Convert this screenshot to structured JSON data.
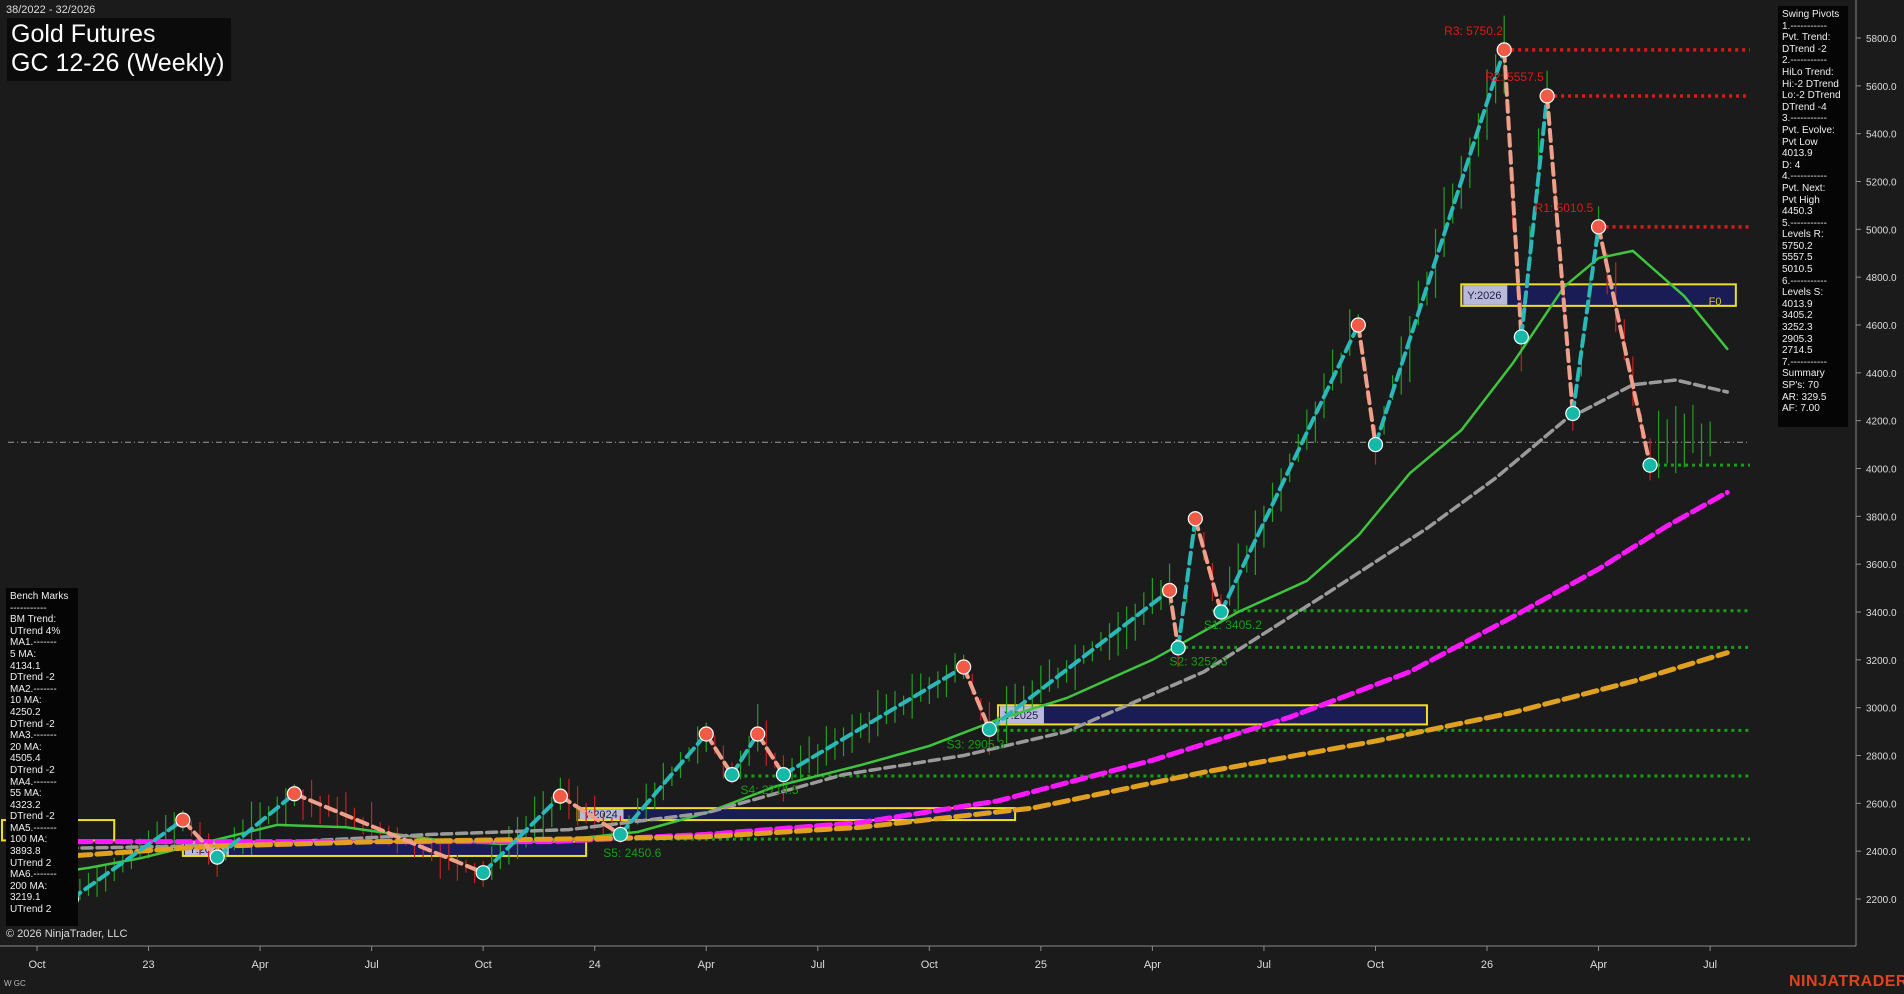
{
  "header": {
    "date_range": "38/2022 - 32/2026",
    "title_line1": "Gold Futures",
    "title_line2": "GC 12-26 (Weekly)"
  },
  "footer": {
    "copyright": "© 2026 NinjaTrader, LLC",
    "symbol": "W GC",
    "brand": "NINJATRADER"
  },
  "swing_pivots_panel": {
    "lines": [
      "Swing Pivots",
      "1.-----------",
      "Pvt. Trend:",
      "DTrend -2",
      "2.-----------",
      "HiLo Trend:",
      "Hi:-2 DTrend",
      "Lo:-2 DTrend",
      "DTrend -4",
      "3.-----------",
      "Pvt. Evolve:",
      "Pvt Low",
      "4013.9",
      "D: 4",
      "4.-----------",
      "Pvt. Next:",
      "Pvt High",
      "4450.3",
      "5.-----------",
      "Levels R:",
      "5750.2",
      "5557.5",
      "5010.5",
      "6.-----------",
      "Levels S:",
      "4013.9",
      "3405.2",
      "3252.3",
      "2905.3",
      "2714.5",
      "7.-----------",
      "Summary",
      "SP's: 70",
      "AR: 329.5",
      "AF: 7.00"
    ]
  },
  "bench_marks_panel": {
    "lines": [
      "Bench Marks",
      "-----------",
      "BM Trend:",
      "UTrend 4%",
      "MA1.-------",
      "5 MA:",
      "4134.1",
      "DTrend -2",
      "MA2.-------",
      "10 MA:",
      "4250.2",
      "DTrend -2",
      "MA3.-------",
      "20 MA:",
      "4505.4",
      "DTrend -2",
      "MA4.-------",
      "55 MA:",
      "4323.2",
      "DTrend -2",
      "MA5.-------",
      "100 MA:",
      "3893.8",
      "UTrend 2",
      "MA6.-------",
      "200 MA:",
      "3219.1",
      "UTrend 2"
    ]
  },
  "chart_data": {
    "type": "candlestick",
    "timeframe": "Weekly",
    "y_axis": {
      "ylim": [
        2100,
        5950
      ],
      "ticks": [
        2200,
        2400,
        2600,
        2800,
        3000,
        3200,
        3400,
        3600,
        3800,
        4000,
        4200,
        4400,
        4600,
        4800,
        5000,
        5200,
        5400,
        5600,
        5800
      ],
      "tick_labels": [
        "2200.0",
        "2400.0",
        "2600.0",
        "2800.0",
        "3000.0",
        "3200.0",
        "3400.0",
        "3600.0",
        "3800.0",
        "4000.0",
        "4200.0",
        "4400.0",
        "4600.0",
        "4800.0",
        "5000.0",
        "5200.0",
        "5400.0",
        "5600.0",
        "5800.0"
      ]
    },
    "x_axis": {
      "labels": [
        "Oct",
        "23",
        "Apr",
        "Jul",
        "Oct",
        "24",
        "Apr",
        "Jul",
        "Oct",
        "25",
        "Apr",
        "Jul",
        "Oct",
        "26",
        "Apr",
        "Jul"
      ],
      "label_week_index": [
        0,
        13,
        26,
        39,
        52,
        65,
        78,
        91,
        104,
        117,
        130,
        143,
        156,
        169,
        182,
        195
      ],
      "total_weeks": 204
    },
    "last_price": 4110,
    "resistance_levels": [
      {
        "label": "R3: 5750.2",
        "value": 5750.2
      },
      {
        "label": "R2: 5557.5",
        "value": 5557.5
      },
      {
        "label": "R1: 5010.5",
        "value": 5010.5
      }
    ],
    "support_levels": [
      {
        "label": "",
        "value": 4013.9
      },
      {
        "label": "S1: 3405.2",
        "value": 3405.2
      },
      {
        "label": "S2: 3252.3",
        "value": 3252.3
      },
      {
        "label": "S3: 2905.3",
        "value": 2905.3
      },
      {
        "label": "S4: 2714.5",
        "value": 2714.5
      },
      {
        "label": "S5: 2450.6",
        "value": 2450.6
      }
    ],
    "swing_pivots": [
      {
        "w": 4,
        "p": 2200,
        "type": "low"
      },
      {
        "w": 17,
        "p": 2530,
        "type": "high"
      },
      {
        "w": 21,
        "p": 2375,
        "type": "low"
      },
      {
        "w": 30,
        "p": 2640,
        "type": "high"
      },
      {
        "w": 52,
        "p": 2310,
        "type": "low"
      },
      {
        "w": 61,
        "p": 2630,
        "type": "high"
      },
      {
        "w": 68,
        "p": 2470,
        "type": "low"
      },
      {
        "w": 78,
        "p": 2890,
        "type": "high"
      },
      {
        "w": 81,
        "p": 2720,
        "type": "low"
      },
      {
        "w": 84,
        "p": 2890,
        "type": "high"
      },
      {
        "w": 87,
        "p": 2720,
        "type": "low"
      },
      {
        "w": 108,
        "p": 3170,
        "type": "high"
      },
      {
        "w": 111,
        "p": 2910,
        "type": "low"
      },
      {
        "w": 132,
        "p": 3490,
        "type": "high"
      },
      {
        "w": 133,
        "p": 3250,
        "type": "low"
      },
      {
        "w": 135,
        "p": 3790,
        "type": "high"
      },
      {
        "w": 138,
        "p": 3400,
        "type": "low"
      },
      {
        "w": 154,
        "p": 4600,
        "type": "high"
      },
      {
        "w": 156,
        "p": 4100,
        "type": "low"
      },
      {
        "w": 171,
        "p": 5750.2,
        "type": "high"
      },
      {
        "w": 173,
        "p": 4550,
        "type": "low"
      },
      {
        "w": 176,
        "p": 5557.5,
        "type": "high"
      },
      {
        "w": 179,
        "p": 4230,
        "type": "low"
      },
      {
        "w": 182,
        "p": 5010.5,
        "type": "high"
      },
      {
        "w": 188,
        "p": 4013.9,
        "type": "low"
      }
    ],
    "moving_averages": [
      {
        "name": "20 MA",
        "color": "#3ec43e",
        "points": [
          [
            0,
            2300
          ],
          [
            6,
            2330
          ],
          [
            12,
            2370
          ],
          [
            20,
            2440
          ],
          [
            28,
            2510
          ],
          [
            36,
            2500
          ],
          [
            46,
            2450
          ],
          [
            54,
            2430
          ],
          [
            62,
            2450
          ],
          [
            70,
            2480
          ],
          [
            78,
            2560
          ],
          [
            86,
            2670
          ],
          [
            96,
            2760
          ],
          [
            104,
            2840
          ],
          [
            112,
            2950
          ],
          [
            120,
            3040
          ],
          [
            130,
            3200
          ],
          [
            140,
            3400
          ],
          [
            148,
            3530
          ],
          [
            154,
            3720
          ],
          [
            160,
            3980
          ],
          [
            166,
            4160
          ],
          [
            172,
            4440
          ],
          [
            178,
            4760
          ],
          [
            182,
            4880
          ],
          [
            186,
            4910
          ],
          [
            192,
            4720
          ],
          [
            197,
            4500
          ]
        ]
      },
      {
        "name": "55 MA",
        "color": "#9a9a9a",
        "points": [
          [
            0,
            2410
          ],
          [
            16,
            2420
          ],
          [
            30,
            2440
          ],
          [
            46,
            2470
          ],
          [
            62,
            2490
          ],
          [
            78,
            2560
          ],
          [
            94,
            2720
          ],
          [
            108,
            2800
          ],
          [
            120,
            2900
          ],
          [
            136,
            3150
          ],
          [
            150,
            3470
          ],
          [
            162,
            3750
          ],
          [
            170,
            3960
          ],
          [
            178,
            4200
          ],
          [
            186,
            4350
          ],
          [
            191,
            4370
          ],
          [
            197,
            4320
          ]
        ]
      },
      {
        "name": "100 MA",
        "color": "#ff19ff",
        "points": [
          [
            0,
            2440
          ],
          [
            20,
            2440
          ],
          [
            40,
            2440
          ],
          [
            60,
            2440
          ],
          [
            78,
            2470
          ],
          [
            96,
            2520
          ],
          [
            112,
            2610
          ],
          [
            130,
            2780
          ],
          [
            146,
            2960
          ],
          [
            160,
            3150
          ],
          [
            172,
            3380
          ],
          [
            182,
            3580
          ],
          [
            190,
            3760
          ],
          [
            197,
            3900
          ]
        ]
      },
      {
        "name": "200 MA",
        "color": "#e0a020",
        "points": [
          [
            0,
            2370
          ],
          [
            20,
            2420
          ],
          [
            40,
            2440
          ],
          [
            60,
            2450
          ],
          [
            78,
            2460
          ],
          [
            96,
            2500
          ],
          [
            116,
            2580
          ],
          [
            136,
            2730
          ],
          [
            156,
            2860
          ],
          [
            172,
            2980
          ],
          [
            186,
            3110
          ],
          [
            197,
            3230
          ]
        ]
      }
    ],
    "yearly_boxes": [
      {
        "label": "Y:2023",
        "w0": 17,
        "w1": 64,
        "low": 2380,
        "high": 2440
      },
      {
        "label": "Y:2024",
        "w0": 63,
        "w1": 114,
        "low": 2530,
        "high": 2580
      },
      {
        "label": "Y:2025",
        "w0": 112,
        "w1": 162,
        "low": 2930,
        "high": 3010
      },
      {
        "label": "Y:2026",
        "w0": 166,
        "w1": 198,
        "low": 4680,
        "high": 4770
      }
    ],
    "yearly_box_extra": {
      "label": "F0"
    },
    "legend_placement": "none",
    "grid": false
  }
}
